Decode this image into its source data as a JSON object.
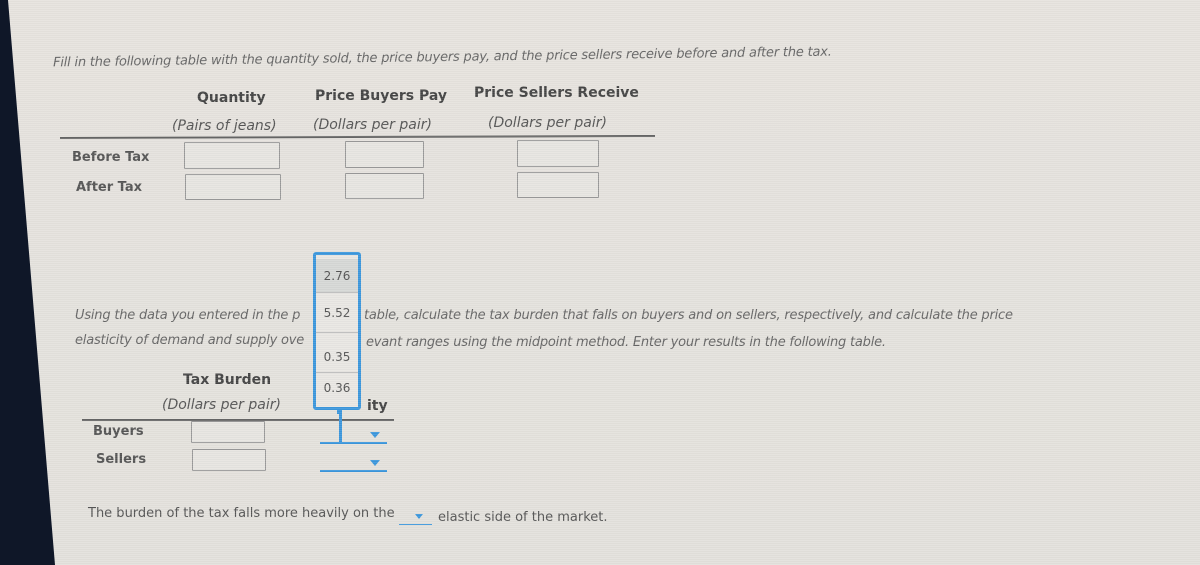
{
  "instructions": {
    "table1": "Fill in the following table with the quantity sold, the price buyers pay, and the price sellers receive before and after the tax.",
    "table2_line1_left": "Using the data you entered in the p",
    "table2_line1_right": "table, calculate the tax burden that falls on buyers and on sellers, respectively, and calculate the price",
    "table2_line2_left": "elasticity of demand and supply ove",
    "table2_line2_right": "evant ranges using the midpoint method. Enter your results in the following table."
  },
  "table1": {
    "columns": [
      {
        "header": "Quantity",
        "sub": "(Pairs of jeans)"
      },
      {
        "header": "Price Buyers Pay",
        "sub": "(Dollars per pair)"
      },
      {
        "header": "Price Sellers Receive",
        "sub": "(Dollars per pair)"
      }
    ],
    "rows": [
      {
        "label": "Before Tax",
        "values": [
          "",
          "",
          ""
        ]
      },
      {
        "label": "After Tax",
        "values": [
          "",
          "",
          ""
        ]
      }
    ]
  },
  "table2": {
    "columns": [
      {
        "header": "Tax Burden",
        "sub": "(Dollars per pair)"
      },
      {
        "header_partial": "ity"
      }
    ],
    "rows": [
      {
        "label": "Buyers",
        "burden": "",
        "elasticity": ""
      },
      {
        "label": "Sellers",
        "burden": "",
        "elasticity": ""
      }
    ]
  },
  "dropdown_popup": {
    "options": [
      "2.76",
      "5.52",
      "0.35",
      "0.36"
    ],
    "highlighted": "2.76"
  },
  "final_sentence": {
    "before": "The burden of the tax falls more heavily on the",
    "selected": "",
    "after": "elastic side of the market."
  },
  "colors": {
    "accent": "#3c97dc",
    "background": "#e4e2dd",
    "screen_edge": "#0f1728"
  }
}
